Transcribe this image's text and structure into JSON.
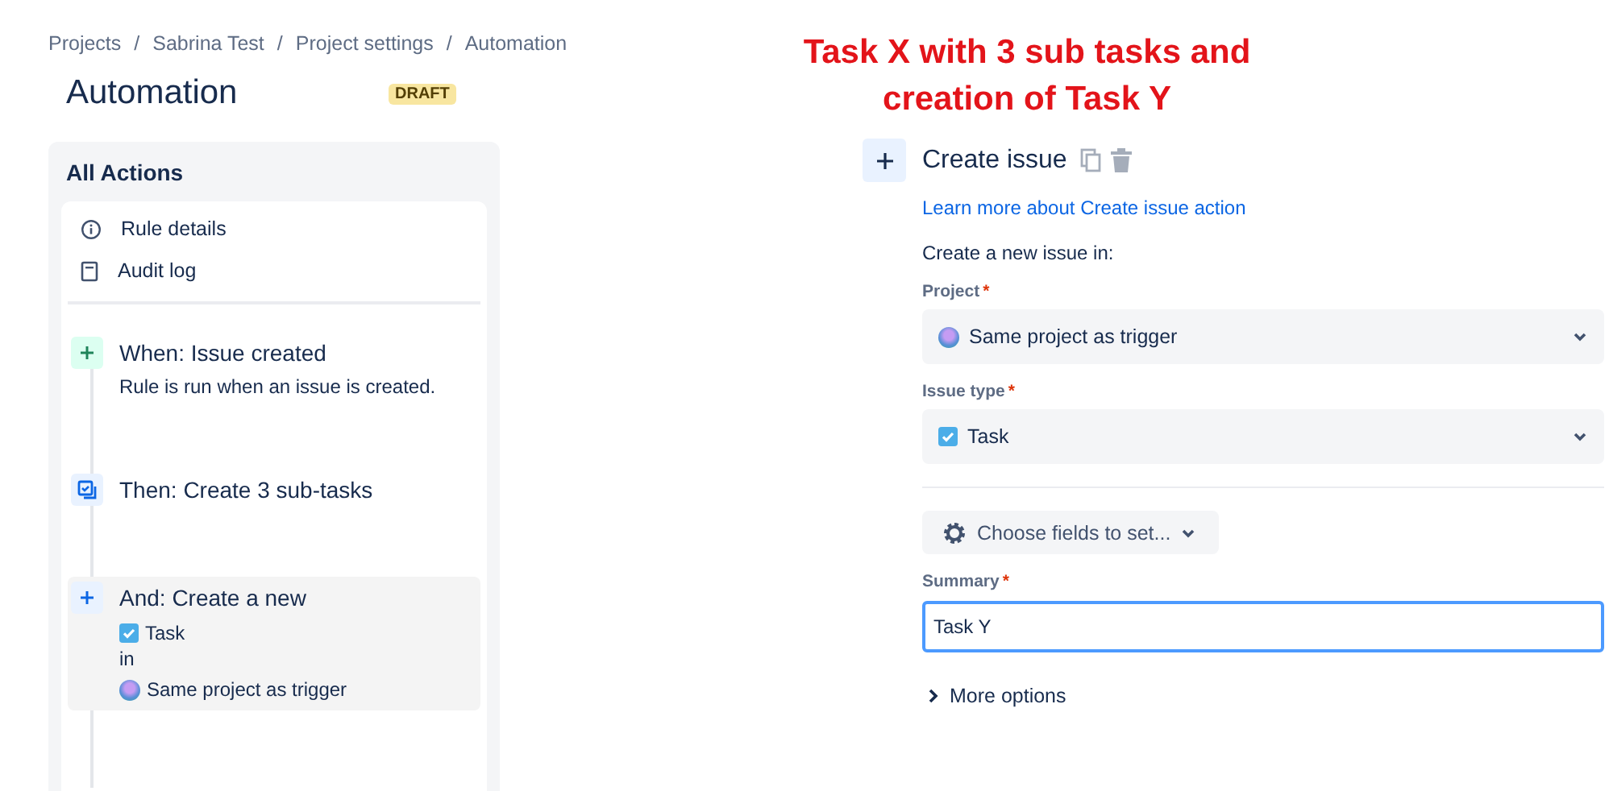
{
  "breadcrumbs": [
    {
      "label": "Projects"
    },
    {
      "separator": "/",
      "label": "Sabrina Test"
    },
    {
      "separator": "/",
      "label": "Project settings"
    },
    {
      "separator": "/",
      "label": "Automation"
    }
  ],
  "page_title": "Automation",
  "status_badge": "DRAFT",
  "annotation": "Task X with 3 sub tasks and creation of Task Y",
  "sidebar": {
    "title": "All Actions",
    "links": [
      {
        "kind": "info",
        "label": "Rule details"
      },
      {
        "kind": "log",
        "label": "Audit log"
      }
    ],
    "steps": [
      {
        "kind": "trigger",
        "title": "When: Issue created",
        "description": "Rule is run when an issue is created.",
        "selected": false
      },
      {
        "kind": "subtasks",
        "title": "Then: Create 3 sub-tasks",
        "selected": false
      },
      {
        "kind": "create",
        "title": "And: Create a new",
        "issue_type": "Task",
        "connector": "in",
        "project": "Same project as trigger",
        "selected": true
      }
    ]
  },
  "editor": {
    "title": "Create issue",
    "learn_link": "Learn more about Create issue action",
    "intro": "Create a new issue in:",
    "project": {
      "label": "Project",
      "required_mark": "*",
      "value": "Same project as trigger"
    },
    "issue_type": {
      "label": "Issue type",
      "required_mark": "*",
      "value": "Task"
    },
    "choose_fields": "Choose fields to set...",
    "summary": {
      "label": "Summary",
      "required_mark": "*",
      "value": "Task Y"
    },
    "more_options": "More options"
  }
}
